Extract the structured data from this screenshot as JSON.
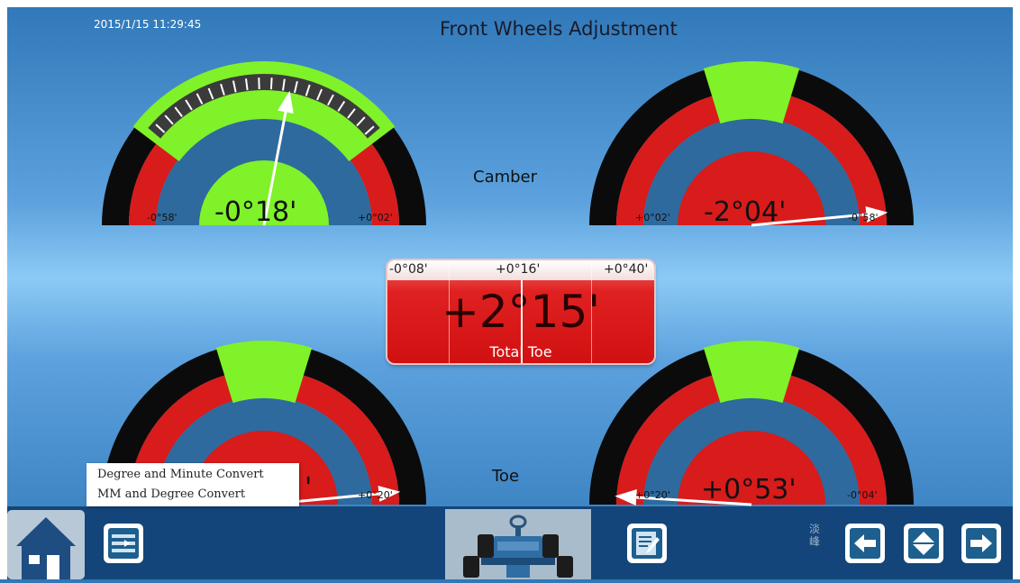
{
  "header": {
    "datetime": "2015/1/15 11:29:45",
    "title": "Front Wheels Adjustment"
  },
  "sections": {
    "camber_label": "Camber",
    "toe_label": "Toe"
  },
  "gauges": [
    {
      "id": "camber-left",
      "value": "-0°18'",
      "left_limit": "-0°58'",
      "right_limit": "+0°02'",
      "in_range": true,
      "needle_fraction": 0.56
    },
    {
      "id": "camber-right",
      "value": "-2°04'",
      "left_limit": "+0°02'",
      "right_limit": "-0°58'",
      "in_range": false,
      "needle_fraction": 0.97
    },
    {
      "id": "toe-left",
      "value": "'",
      "left_limit": "",
      "right_limit": "+0°20'",
      "in_range": false,
      "needle_fraction": 0.97
    },
    {
      "id": "toe-right",
      "value": "+0°53'",
      "left_limit": "+0°20'",
      "right_limit": "-0°04'",
      "in_range": false,
      "needle_fraction": 0.02
    }
  ],
  "total_toe": {
    "label": "Total Toe",
    "value": "+2°15'",
    "scale_left": "-0°08'",
    "scale_center": "+0°16'",
    "scale_right": "+0°40'"
  },
  "menu": {
    "item1": "Degree and Minute Convert",
    "item2": "MM and Degree Convert"
  },
  "toolbar": {
    "mode_glyph": "淡\n峰"
  },
  "colors": {
    "ok_green": "#7ff22a",
    "alarm_red": "#d81b1b",
    "dial_bg": "#2e6a9d",
    "ring_black": "#0b0b0b"
  },
  "icons": [
    "home-icon",
    "convert-icon",
    "vehicle-icon",
    "report-icon",
    "back-arrow-icon",
    "level-icon",
    "forward-arrow-icon"
  ]
}
